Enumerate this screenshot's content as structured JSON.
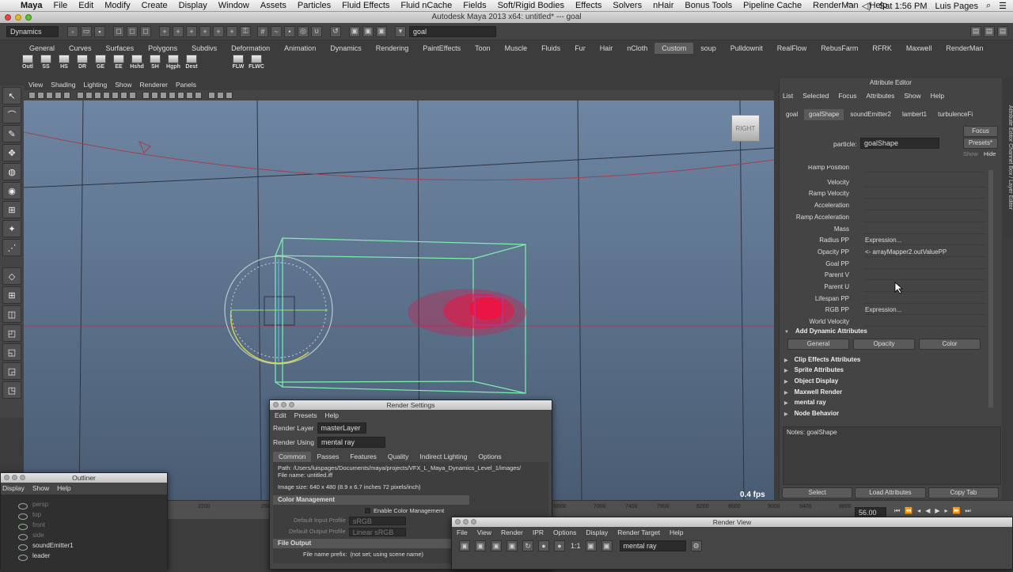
{
  "macbar": {
    "app": "Maya",
    "menus": [
      "File",
      "Edit",
      "Modify",
      "Create",
      "Display",
      "Window",
      "Assets",
      "Particles",
      "Fluid Effects",
      "Fluid nCache",
      "Fields",
      "Soft/Rigid Bodies",
      "Effects",
      "Solvers",
      "nHair",
      "Bonus Tools",
      "Pipeline Cache",
      "RenderMan",
      "Help"
    ],
    "clock": "Sat 1:56 PM",
    "user": "Luis Pages"
  },
  "window_title": "Autodesk Maya 2013 x64: untitled*   ---   goal",
  "statusline": {
    "menuset": "Dynamics",
    "input_value": "goal"
  },
  "shelf": {
    "tabs": [
      "General",
      "Curves",
      "Surfaces",
      "Polygons",
      "Subdivs",
      "Deformation",
      "Animation",
      "Dynamics",
      "Rendering",
      "PaintEffects",
      "Toon",
      "Muscle",
      "Fluids",
      "Fur",
      "Hair",
      "nCloth",
      "Custom",
      "soup",
      "Pulldownit",
      "RealFlow",
      "RebusFarm",
      "RFRK",
      "Maxwell",
      "RenderMan"
    ],
    "active_tab": "Custom",
    "buttons": [
      "Outl",
      "SS",
      "HS",
      "DR",
      "GE",
      "EE",
      "Hshd",
      "SH",
      "Hgph",
      "Dest",
      "FLW",
      "FLWC"
    ]
  },
  "viewport": {
    "menus": [
      "View",
      "Shading",
      "Lighting",
      "Show",
      "Renderer",
      "Panels"
    ],
    "viewcube": "RIGHT",
    "fps": "0.4 fps"
  },
  "attribute_editor": {
    "title": "Attribute Editor",
    "menus": [
      "List",
      "Selected",
      "Focus",
      "Attributes",
      "Show",
      "Help"
    ],
    "tabs": [
      "goal",
      "goalShape",
      "soundEmitter2",
      "lambert1",
      "turbulenceFi"
    ],
    "active_tab": "goalShape",
    "focus_btn": "Focus",
    "presets_btn": "Presets*",
    "show_btn": "Show",
    "hide_btn": "Hide",
    "particle_label": "particle:",
    "particle_value": "goalShape",
    "attributes": [
      {
        "label": "Ramp Position",
        "value": ""
      },
      {
        "label": "Velocity",
        "value": ""
      },
      {
        "label": "Ramp Velocity",
        "value": ""
      },
      {
        "label": "Acceleration",
        "value": ""
      },
      {
        "label": "Ramp Acceleration",
        "value": ""
      },
      {
        "label": "Mass",
        "value": ""
      },
      {
        "label": "Radius PP",
        "value": "Expression..."
      },
      {
        "label": "Opacity PP",
        "value": "<- arrayMapper2.outValuePP"
      },
      {
        "label": "Goal PP",
        "value": ""
      },
      {
        "label": "Parent V",
        "value": ""
      },
      {
        "label": "Parent U",
        "value": ""
      },
      {
        "label": "Lifespan PP",
        "value": ""
      },
      {
        "label": "RGB PP",
        "value": "Expression..."
      },
      {
        "label": "World Velocity",
        "value": ""
      }
    ],
    "add_dynamic": "Add Dynamic Attributes",
    "dyn_buttons": [
      "General",
      "Opacity",
      "Color"
    ],
    "sections": [
      "Clip Effects Attributes",
      "Sprite Attributes",
      "Object Display",
      "Maxwell Render",
      "mental ray",
      "Node Behavior"
    ],
    "notes": "Notes:  goalShape",
    "bottom_buttons": [
      "Select",
      "Load Attributes",
      "Copy Tab"
    ]
  },
  "sidebar": "Attribute Editor   Channel Box / Layer Editor",
  "timeline": {
    "ticks": [
      "2200",
      "2600",
      "6600",
      "7000",
      "7400",
      "7800",
      "8200",
      "8600",
      "9000",
      "9400",
      "9800"
    ],
    "current": "56.00"
  },
  "render_settings": {
    "title": "Render Settings",
    "menus": [
      "Edit",
      "Presets",
      "Help"
    ],
    "layer_label": "Render Layer",
    "layer_value": "masterLayer",
    "using_label": "Render Using",
    "using_value": "mental ray",
    "tabs": [
      "Common",
      "Passes",
      "Features",
      "Quality",
      "Indirect Lighting",
      "Options"
    ],
    "active_tab": "Common",
    "path": "Path: /Users/luispages/Documents/maya/projects/VFX_L_Maya_Dynamics_Level_1/images/",
    "filename": "File name:  untitled.iff",
    "imagesize": "Image size: 640 x 480 (8.9 x 6.7 inches 72 pixels/inch)",
    "color_mgmt": "Color Management",
    "enable_cm": "Enable Color Management",
    "input_profile_label": "Default Input Profile",
    "input_profile_value": "sRGB",
    "output_profile_label": "Default Output Profile",
    "output_profile_value": "Linear sRGB",
    "file_output": "File Output",
    "prefix_label": "File name prefix:",
    "prefix_value": "(not set; using scene name)"
  },
  "outliner": {
    "title": "Outliner",
    "menus": [
      "Display",
      "Show",
      "Help"
    ],
    "items": [
      {
        "name": "persp",
        "dim": true
      },
      {
        "name": "top",
        "dim": true
      },
      {
        "name": "front",
        "dim": true
      },
      {
        "name": "side",
        "dim": true
      },
      {
        "name": "soundEmitter1",
        "dim": false
      },
      {
        "name": "leader",
        "dim": false
      }
    ]
  },
  "render_view": {
    "title": "Render View",
    "menus": [
      "File",
      "View",
      "Render",
      "IPR",
      "Options",
      "Display",
      "Render Target",
      "Help"
    ],
    "ratio": "1:1",
    "renderer": "mental ray"
  }
}
